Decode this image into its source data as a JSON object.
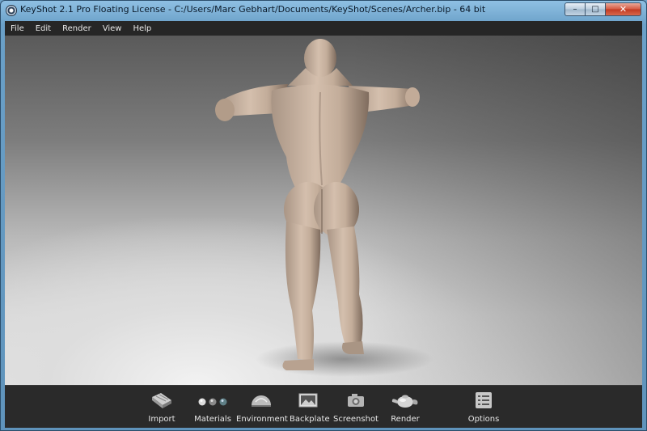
{
  "window": {
    "title": "KeyShot 2.1 Pro Floating License  - C:/Users/Marc Gebhart/Documents/KeyShot/Scenes/Archer.bip  - 64 bit",
    "buttons": {
      "minimize": "–",
      "maximize": "□",
      "close": "✕"
    }
  },
  "menu": {
    "items": [
      "File",
      "Edit",
      "Render",
      "View",
      "Help"
    ]
  },
  "viewport": {
    "subject": "3D muscular human figure model, rear view, arms outstretched"
  },
  "toolbar": {
    "items": [
      {
        "label": "Import",
        "icon": "import-icon"
      },
      {
        "label": "Materials",
        "icon": "materials-icon"
      },
      {
        "label": "Environment",
        "icon": "environment-icon"
      },
      {
        "label": "Backplate",
        "icon": "backplate-icon"
      },
      {
        "label": "Screenshot",
        "icon": "camera-icon"
      },
      {
        "label": "Render",
        "icon": "teapot-icon"
      },
      {
        "label": "Options",
        "icon": "options-icon"
      }
    ]
  },
  "colors": {
    "menubar": "#262626",
    "toolbar": "#2a2a2a",
    "frame": "#6fa3c9",
    "close_button": "#c8442a"
  }
}
